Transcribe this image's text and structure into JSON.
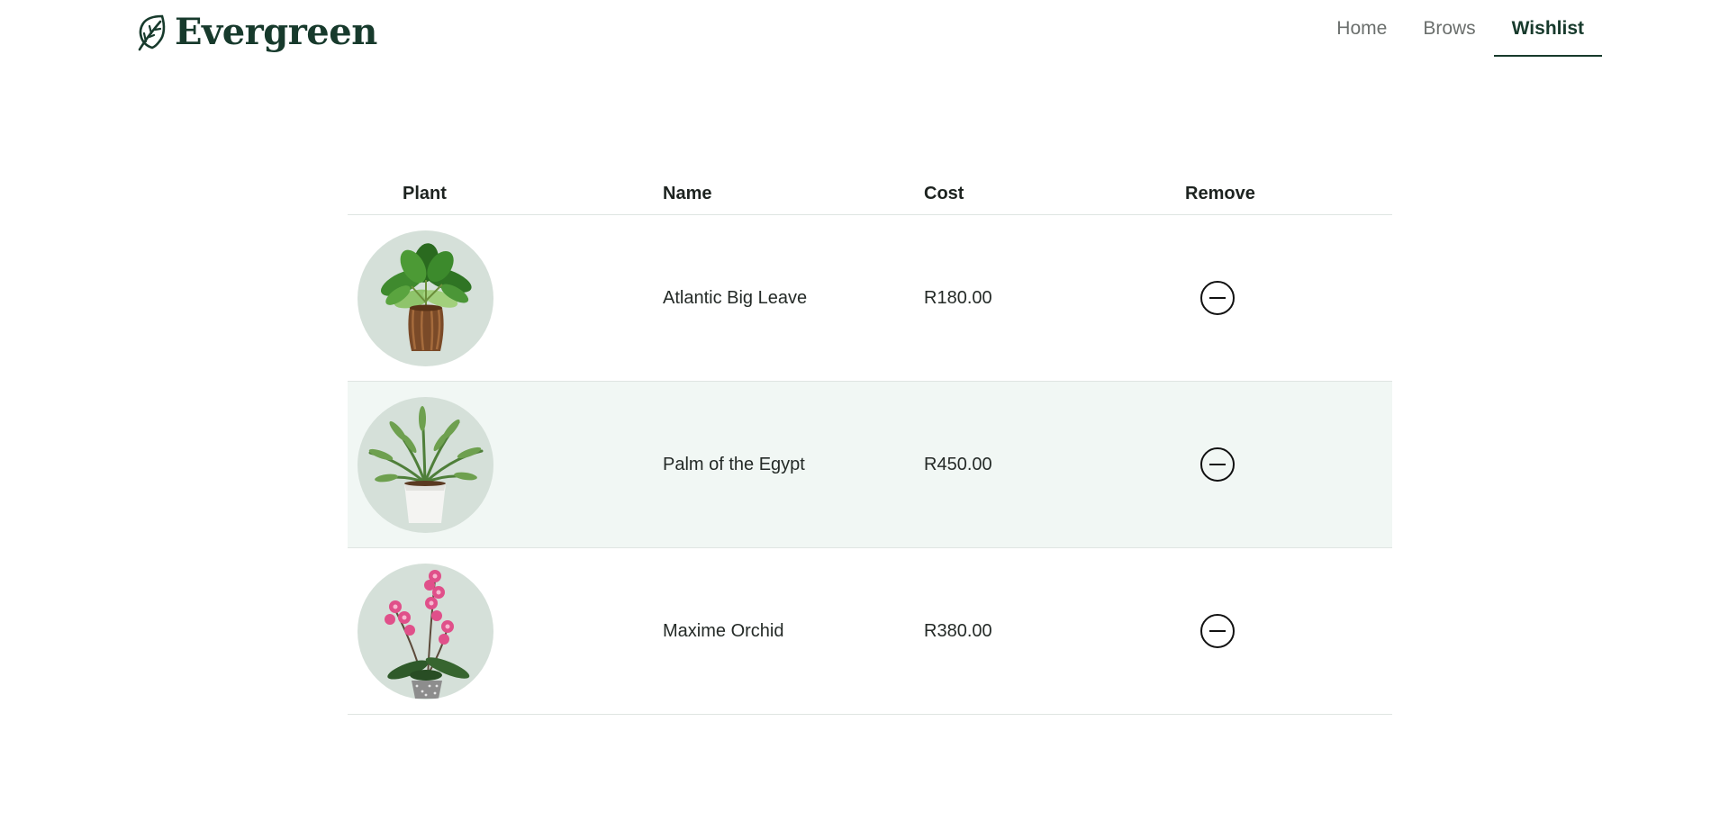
{
  "brand": {
    "name": "Evergreen",
    "logo_icon": "leaf-icon",
    "color": "#173a2c"
  },
  "nav": {
    "items": [
      {
        "label": "Home"
      },
      {
        "label": "Brows"
      },
      {
        "label": "Wishlist",
        "active": true
      }
    ]
  },
  "wishlist": {
    "columns": {
      "plant": "Plant",
      "name": "Name",
      "cost": "Cost",
      "remove": "Remove"
    },
    "rows": [
      {
        "name": "Atlantic Big Leave",
        "cost": "R180.00",
        "image_icon": "potted-leafy-plant-icon",
        "remove_icon": "minus-circle-icon"
      },
      {
        "name": "Palm of the Egypt",
        "cost": "R450.00",
        "image_icon": "potted-palm-icon",
        "remove_icon": "minus-circle-icon"
      },
      {
        "name": "Maxime Orchid",
        "cost": "R380.00",
        "image_icon": "orchid-icon",
        "remove_icon": "minus-circle-icon"
      }
    ]
  },
  "colors": {
    "accent": "#173a2c",
    "row_highlight": "#f1f7f4",
    "image_bg": "#d5e0d9",
    "divider": "#dfe5e2"
  }
}
